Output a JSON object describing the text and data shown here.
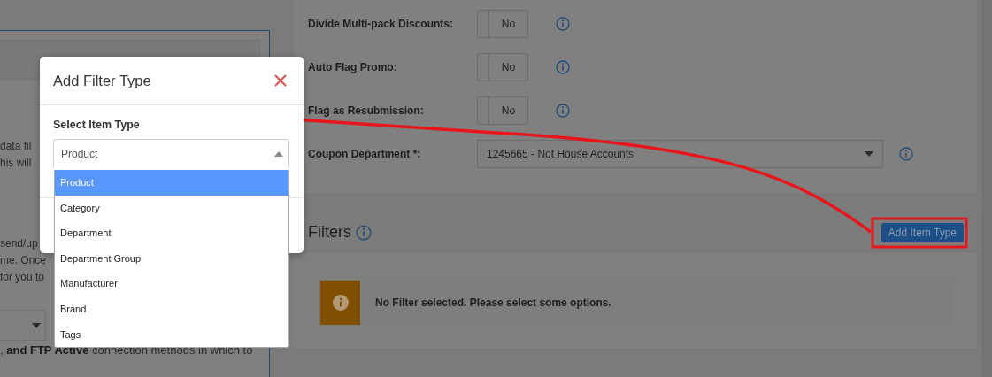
{
  "background_form": {
    "intro_fragments": [
      "data fil",
      "his will"
    ],
    "detail_fragments": [
      "send/up",
      "me. Once",
      "for you to"
    ],
    "methods_text": ", **and FTP Active** connection methods in which to"
  },
  "settings": [
    {
      "kind": "toggle",
      "label": "Divide Multi-pack Discounts:",
      "value": "No",
      "on": false
    },
    {
      "kind": "toggle",
      "label": "Auto Flag Promo:",
      "value": "No",
      "on": false
    },
    {
      "kind": "toggle",
      "label": "Flag as Resubmission:",
      "value": "No",
      "on": false
    },
    {
      "kind": "select",
      "label": "Coupon Department *:",
      "value": "1245665 - Not House Accounts"
    }
  ],
  "filters": {
    "title": "Filters",
    "button": "Add Item Type",
    "message": "No Filter selected. Please select some options."
  },
  "dialog": {
    "title": "Add Filter Type",
    "field_label": "Select Item Type",
    "value": "Product",
    "options": [
      {
        "label": "Product",
        "selected": true
      },
      {
        "label": "Category",
        "selected": false
      },
      {
        "label": "Department",
        "selected": false
      },
      {
        "label": "Department Group",
        "selected": false
      },
      {
        "label": "Manufacturer",
        "selected": false
      },
      {
        "label": "Brand",
        "selected": false
      },
      {
        "label": "Tags",
        "selected": false
      }
    ]
  }
}
